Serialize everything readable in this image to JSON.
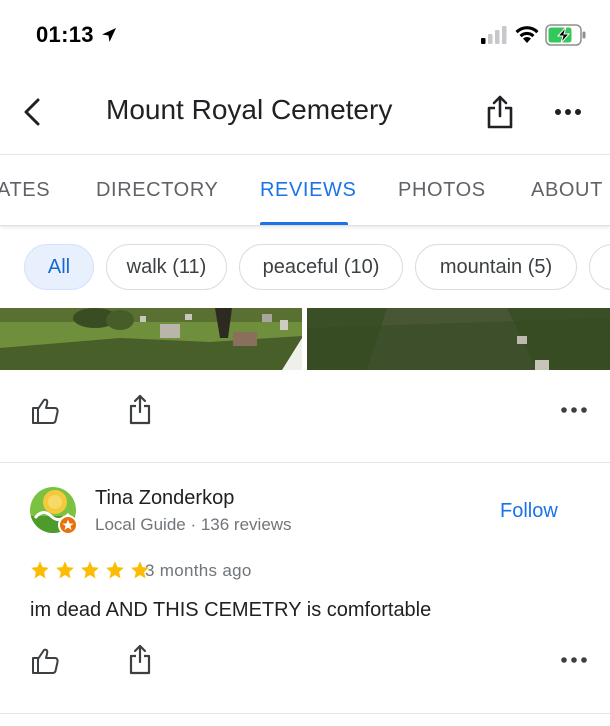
{
  "status_bar": {
    "time": "01:13"
  },
  "header": {
    "title": "Mount Royal Cemetery"
  },
  "tabs": [
    {
      "label": "ATES",
      "active": false
    },
    {
      "label": "DIRECTORY",
      "active": false
    },
    {
      "label": "REVIEWS",
      "active": true
    },
    {
      "label": "PHOTOS",
      "active": false
    },
    {
      "label": "ABOUT",
      "active": false
    }
  ],
  "chips": [
    {
      "label": "All",
      "active": true
    },
    {
      "label": "walk (11)",
      "active": false
    },
    {
      "label": "peaceful (10)",
      "active": false
    },
    {
      "label": "mountain (5)",
      "active": false
    }
  ],
  "review": {
    "reviewer_name": "Tina Zonderkop",
    "reviewer_sub": "Local Guide · 136 reviews",
    "follow_label": "Follow",
    "rating": 5,
    "date": "3 months ago",
    "text": "im dead AND THIS CEMETRY is comfortable"
  },
  "colors": {
    "accent": "#1a73e8",
    "star": "#fbbc04",
    "chip_active_bg": "#e8f0fe"
  },
  "icons": {
    "back": "chevron-left-icon",
    "share": "share-icon",
    "more": "more-horizontal-icon",
    "like": "thumbs-up-icon"
  }
}
